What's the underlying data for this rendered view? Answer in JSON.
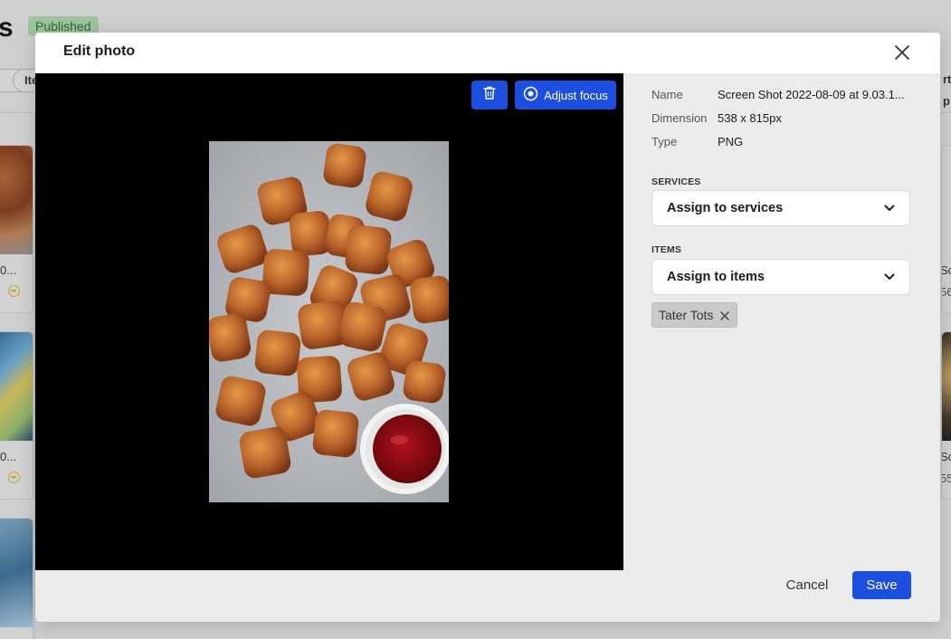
{
  "background": {
    "page_title": "s",
    "status_badge": "Published",
    "filter_chip": "Ite",
    "right_chip": "rt p",
    "cards": [
      {
        "title": "0...",
        "sub": ""
      },
      {
        "title": "0...",
        "sub": ""
      },
      {
        "title": "Sc",
        "sub": "56"
      },
      {
        "title": "Sc",
        "sub": "55"
      }
    ]
  },
  "modal": {
    "title": "Edit photo",
    "close_icon": "close-icon",
    "toolbar": {
      "delete_icon": "trash-icon",
      "adjust_focus_label": "Adjust focus",
      "adjust_focus_icon": "target-icon"
    },
    "photo_description_icon": "image-preview",
    "details": {
      "name_label": "Name",
      "name_value": "Screen Shot 2022-08-09 at 9.03.1...",
      "dimension_label": "Dimension",
      "dimension_value": "538 x 815px",
      "type_label": "Type",
      "type_value": "PNG"
    },
    "services": {
      "section_label": "SERVICES",
      "select_value": "Assign to services"
    },
    "items": {
      "section_label": "ITEMS",
      "select_value": "Assign to items",
      "tags": [
        "Tater Tots"
      ]
    },
    "footer": {
      "cancel_label": "Cancel",
      "save_label": "Save"
    }
  },
  "colors": {
    "primary": "#1c4fe0",
    "overlay": "#a6a6a6",
    "preview_bg": "#000000",
    "panel_bg": "#ebebeb"
  }
}
